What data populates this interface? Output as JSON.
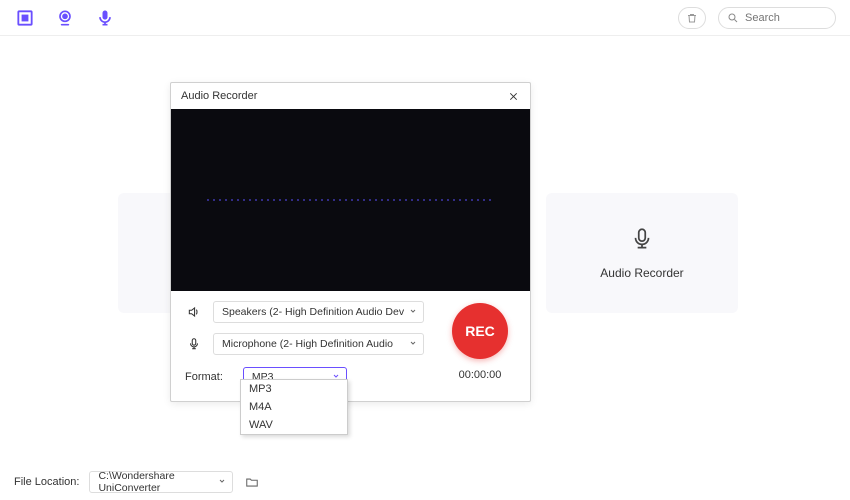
{
  "topbar": {
    "search_placeholder": "Search"
  },
  "background": {
    "right_card_label": "Audio Recorder"
  },
  "modal": {
    "title": "Audio Recorder",
    "speaker_icon": "speaker-icon",
    "mic_icon": "microphone-icon",
    "speaker_device": "Speakers (2- High Definition Audio Dev",
    "mic_device": "Microphone (2- High Definition Audio",
    "format_label": "Format:",
    "format_selected": "MP3",
    "format_options": [
      "MP3",
      "M4A",
      "WAV"
    ],
    "rec_label": "REC",
    "rec_time": "00:00:00"
  },
  "bottombar": {
    "label": "File Location:",
    "path": "C:\\Wondershare UniConverter"
  },
  "colors": {
    "accent": "#6a4fff",
    "rec": "#e6302f"
  }
}
